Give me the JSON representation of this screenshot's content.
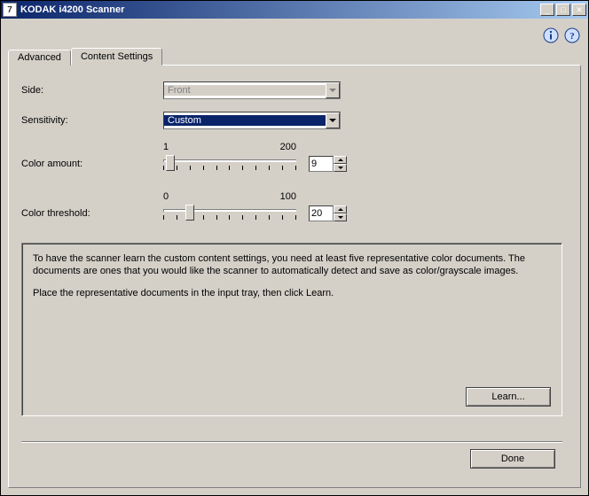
{
  "window": {
    "title": "KODAK i4200 Scanner"
  },
  "tabs": {
    "advanced": "Advanced",
    "content": "Content Settings"
  },
  "labels": {
    "side": "Side:",
    "sensitivity": "Sensitivity:",
    "color_amount": "Color amount:",
    "color_threshold": "Color threshold:"
  },
  "side": {
    "value": "Front"
  },
  "sensitivity": {
    "value": "Custom"
  },
  "color_amount": {
    "min": "1",
    "max": "200",
    "value": "9"
  },
  "color_threshold": {
    "min": "0",
    "max": "100",
    "value": "20"
  },
  "info": {
    "p1": "To have the scanner learn the custom content settings, you need at least five representative color documents. The documents are ones that you would like the scanner to automatically detect and save as color/grayscale images.",
    "p2": "Place the representative documents in the input tray, then click Learn."
  },
  "buttons": {
    "learn": "Learn...",
    "done": "Done"
  }
}
